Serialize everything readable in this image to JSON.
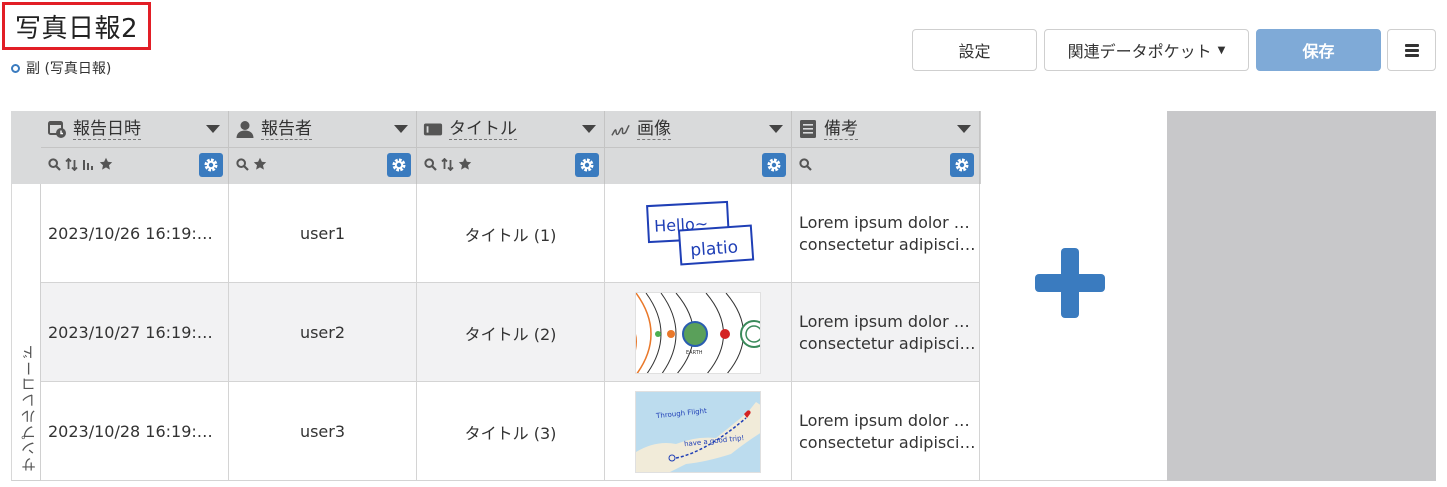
{
  "page": {
    "title": "写真日報2",
    "subtitle": "副 (写真日報)"
  },
  "toolbar": {
    "settings_label": "設定",
    "pocket_label": "関連データポケット",
    "save_label": "保存"
  },
  "columns": [
    {
      "label": "報告日時",
      "icon": "calendar-clock-icon",
      "tools": [
        "search-icon",
        "sort-icon",
        "aggregate-icon",
        "star-icon"
      ]
    },
    {
      "label": "報告者",
      "icon": "person-icon",
      "tools": [
        "search-icon",
        "star-icon"
      ]
    },
    {
      "label": "タイトル",
      "icon": "text-field-icon",
      "tools": [
        "search-icon",
        "sort-icon",
        "star-icon"
      ]
    },
    {
      "label": "画像",
      "icon": "drawing-icon",
      "tools": []
    },
    {
      "label": "備考",
      "icon": "document-icon",
      "tools": [
        "search-icon"
      ]
    }
  ],
  "side_label": "サンプルレコード",
  "rows": [
    {
      "date": "2023/10/26 16:19:…",
      "user": "user1",
      "title": "タイトル (1)",
      "image": "hello-platio-sketch",
      "note1": "Lorem ipsum dolor …",
      "note2": "consectetur adipisci…"
    },
    {
      "date": "2023/10/27 16:19:…",
      "user": "user2",
      "title": "タイトル (2)",
      "image": "solar-system-sketch",
      "note1": "Lorem ipsum dolor …",
      "note2": "consectetur adipisci…"
    },
    {
      "date": "2023/10/28 16:19:…",
      "user": "user3",
      "title": "タイトル (3)",
      "image": "flight-map-sketch",
      "note1": "Lorem ipsum dolor …",
      "note2": "consectetur adipisci…"
    }
  ],
  "image_text": {
    "hello": "Hello~",
    "platio": "platio",
    "earth": "EARTH",
    "flight": "Through Flight",
    "trip": "have a good trip!"
  },
  "colors": {
    "accent": "#3a7bbf",
    "save_button": "#7faad7",
    "title_border": "#e21e26",
    "header_bg": "#d9dadb",
    "right_panel": "#c8c8ca"
  }
}
